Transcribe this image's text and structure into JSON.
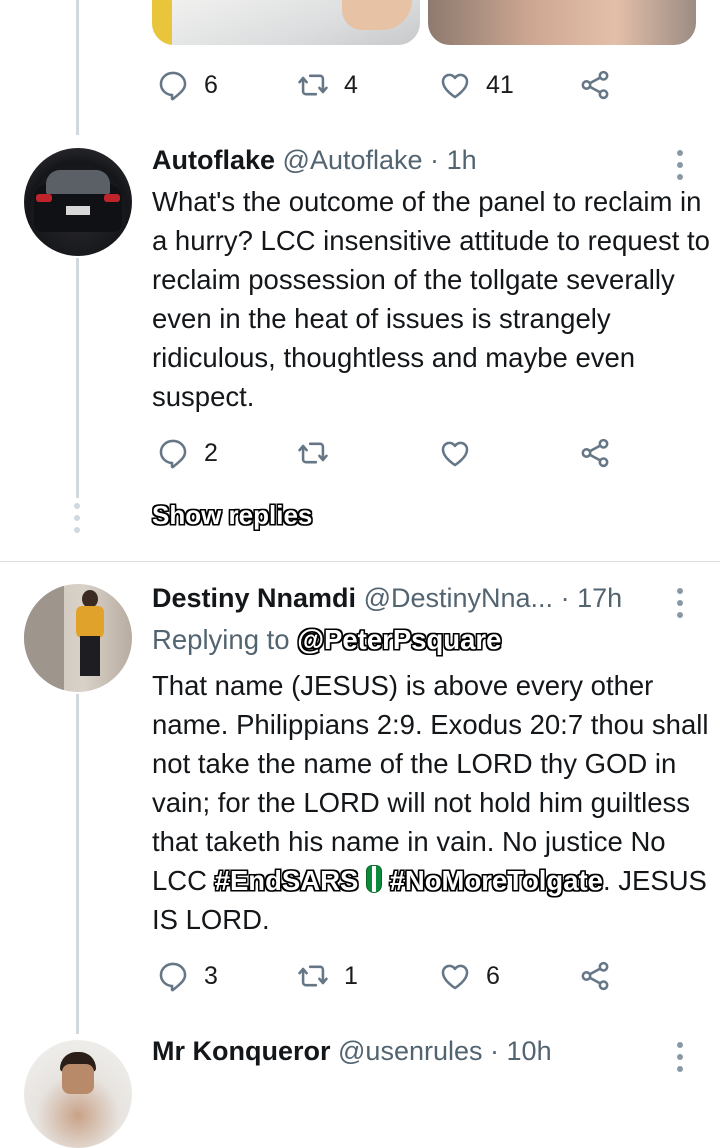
{
  "tweet_prev": {
    "actions": {
      "replies": "6",
      "retweets": "4",
      "likes": "41"
    }
  },
  "tweet1": {
    "display_name": "Autoflake",
    "handle": "@Autoflake",
    "sep": "·",
    "time": "1h",
    "text": "What's the outcome of the panel to reclaim in a hurry? LCC insensitive attitude to request to reclaim possession of the tollgate severally even in the heat of issues is strangely ridiculous, thoughtless and maybe even suspect.",
    "actions": {
      "replies": "2",
      "retweets": "",
      "likes": ""
    },
    "show_replies": "Show replies"
  },
  "tweet2": {
    "display_name": "Destiny Nnamdi",
    "handle": "@DestinyNna...",
    "sep": "·",
    "time": "17h",
    "replying_prefix": "Replying to ",
    "replying_to": "@PeterPsquare",
    "text_main": "That name (JESUS) is above every other name. Philippians 2:9. Exodus 20:7 thou shall not take the name of the LORD thy GOD in vain; for the LORD will not hold him guiltless that taketh his name in vain. No justice No LCC ",
    "hashtag1": "#EndSARS",
    "hashtag2": "#NoMoreTolgate",
    "text_end": ". JESUS IS LORD.",
    "actions": {
      "replies": "3",
      "retweets": "1",
      "likes": "6"
    }
  },
  "tweet3": {
    "display_name": "Mr Konqueror",
    "handle": "@usenrules",
    "sep": "·",
    "time": "10h"
  },
  "icons": {
    "reply": "reply-icon",
    "retweet": "retweet-icon",
    "like": "like-icon",
    "share": "share-icon",
    "more": "more-options-icon",
    "flag": "nigeria-flag-emoji-icon"
  },
  "colors": {
    "icon_gray": "#657786",
    "thread_line": "#cfd9de",
    "divider": "#d9dee2"
  }
}
